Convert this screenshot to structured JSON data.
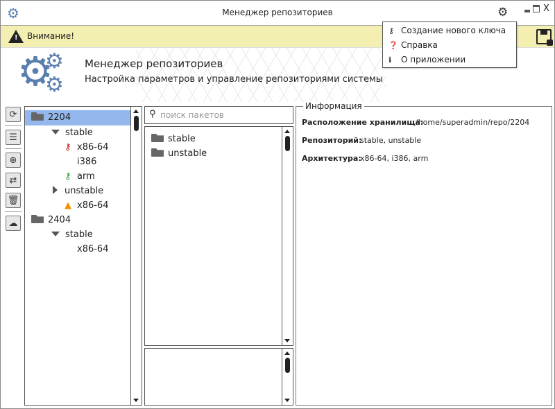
{
  "window": {
    "title": "Менеджер репозиториев",
    "minimize": "▁",
    "maximize": "□",
    "close": "X"
  },
  "warning": {
    "text": "Внимание!"
  },
  "header": {
    "title": "Менеджер репозиториев",
    "subtitle": "Настройка параметров и управление репозиториями системы"
  },
  "menu": {
    "items": [
      {
        "icon": "key-icon",
        "label": "Создание нового ключа"
      },
      {
        "icon": "help-icon",
        "label": "Справка"
      },
      {
        "icon": "info-icon",
        "label": "О приложении"
      }
    ]
  },
  "toolbar": [
    "refresh",
    "database",
    "add",
    "swap",
    "delete",
    "upload"
  ],
  "tree": [
    {
      "label": "2204",
      "level": 0,
      "type": "folder",
      "selected": true
    },
    {
      "label": "stable",
      "level": 1,
      "type": "expanded"
    },
    {
      "label": "x86-64",
      "level": 2,
      "type": "key-red"
    },
    {
      "label": "i386",
      "level": 2,
      "type": "none"
    },
    {
      "label": "arm",
      "level": 2,
      "type": "key-green"
    },
    {
      "label": "unstable",
      "level": 1,
      "type": "collapsed"
    },
    {
      "label": "x86-64",
      "level": 2,
      "type": "warning"
    },
    {
      "label": "2404",
      "level": 0,
      "type": "folder"
    },
    {
      "label": "stable",
      "level": 1,
      "type": "expanded"
    },
    {
      "label": "x86-64",
      "level": 2,
      "type": "none"
    }
  ],
  "search": {
    "placeholder": "поиск пакетов"
  },
  "packages": [
    "stable",
    "unstable"
  ],
  "info": {
    "group_title": "Информация",
    "storage_label": "Расположение хранилища:",
    "storage_value": "/home/superadmin/repo/2204",
    "repo_label": "Репозиторий:",
    "repo_value": "stable, unstable",
    "arch_label": "Архитектура:",
    "arch_value": "x86-64, i386, arm"
  },
  "colors": {
    "warning_bg": "#f3efb0",
    "selected": "#94b8ee",
    "accent": "#5a7fae",
    "key_red": "#cc0000",
    "key_green": "#1a9a1a",
    "warn_orange": "#f39200"
  }
}
